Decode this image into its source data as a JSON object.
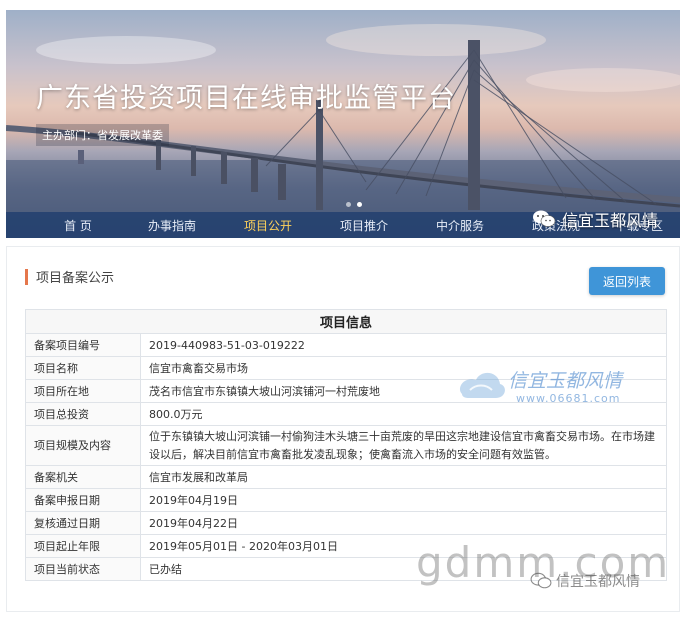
{
  "banner": {
    "title": "广东省投资项目在线审批监管平台",
    "subtitle": "主办部门：省发展改革委"
  },
  "nav": {
    "items": [
      {
        "label": "首 页"
      },
      {
        "label": "办事指南"
      },
      {
        "label": "项目公开"
      },
      {
        "label": "项目推介"
      },
      {
        "label": "中介服务"
      },
      {
        "label": "政策法规"
      },
      {
        "label": "下载专区"
      }
    ],
    "active_index": 2
  },
  "watermarks": {
    "wechat_top": "信宜玉都风情",
    "site_cn": "信宜玉都风情",
    "site_url": "www.06681.com",
    "gdmm": "gdmm.com",
    "wechat_bottom": "信宜玉都风情"
  },
  "panel": {
    "heading": "项目备案公示",
    "back_button": "返回列表",
    "table_title": "项目信息",
    "rows": [
      {
        "label": "备案项目编号",
        "value": "2019-440983-51-03-019222"
      },
      {
        "label": "项目名称",
        "value": "信宜市禽畜交易市场"
      },
      {
        "label": "项目所在地",
        "value": "茂名市信宜市东镇镇大坡山河滨铺河一村荒废地"
      },
      {
        "label": "项目总投资",
        "value": "800.0万元"
      },
      {
        "label": "项目规模及内容",
        "value": "位于东镇镇大坡山河滨铺一村偷狗洼木头塘三十亩荒废的旱田这宗地建设信宜市禽畜交易市场。在市场建设以后，解决目前信宜市禽畜批发凌乱现象；使禽畜流入市场的安全问题有效监管。"
      },
      {
        "label": "备案机关",
        "value": "信宜市发展和改革局"
      },
      {
        "label": "备案申报日期",
        "value": "2019年04月19日"
      },
      {
        "label": "复核通过日期",
        "value": "2019年04月22日"
      },
      {
        "label": "项目起止年限",
        "value": "2019年05月01日 - 2020年03月01日"
      },
      {
        "label": "项目当前状态",
        "value": "已办结"
      }
    ]
  },
  "colors": {
    "nav_bg": "#22406e",
    "nav_active": "#ffd25a",
    "accent": "#e5774c",
    "button": "#3f95d8"
  }
}
